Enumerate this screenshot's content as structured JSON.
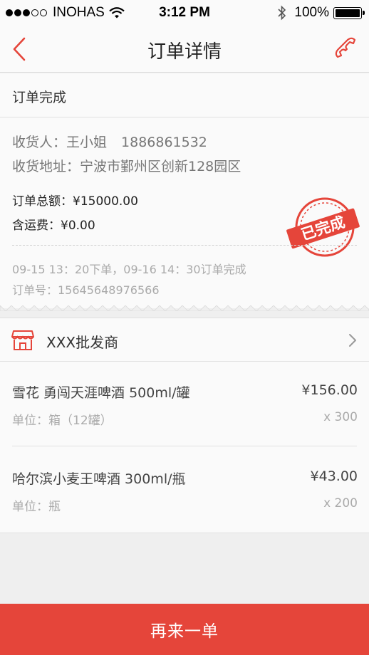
{
  "status_bar": {
    "carrier": "INOHAS",
    "time": "3:12 PM",
    "battery": "100%",
    "signal_strength": 3,
    "signal_max": 5
  },
  "nav": {
    "title": "订单详情",
    "back_icon": "chevron-left-icon",
    "phone_icon": "phone-icon"
  },
  "order": {
    "status": "订单完成",
    "recipient_label": "收货人：王小姐",
    "recipient_phone": "1886861532",
    "address": "收货地址：宁波市鄞州区创新128园区",
    "total": "订单总额：¥15000.00",
    "shipping": "含运费：¥0.00",
    "timeline": "09-15 13：20下单，09-16 14：30订单完成",
    "order_number": "订单号：15645648976566",
    "stamp_text": "已完成"
  },
  "shop": {
    "name": "XXX批发商",
    "icon": "store-icon"
  },
  "items": [
    {
      "name": "雪花 勇闯天涯啤酒 500ml/罐",
      "price": "¥156.00",
      "unit": "单位：箱（12罐）",
      "quantity": "x 300"
    },
    {
      "name": "哈尔滨小麦王啤酒 300ml/瓶",
      "price": "¥43.00",
      "unit": "单位：瓶",
      "quantity": "x 200"
    }
  ],
  "actions": {
    "reorder": "再来一单"
  },
  "colors": {
    "accent": "#e5453a",
    "background": "#efefef",
    "card": "#fafafa"
  }
}
